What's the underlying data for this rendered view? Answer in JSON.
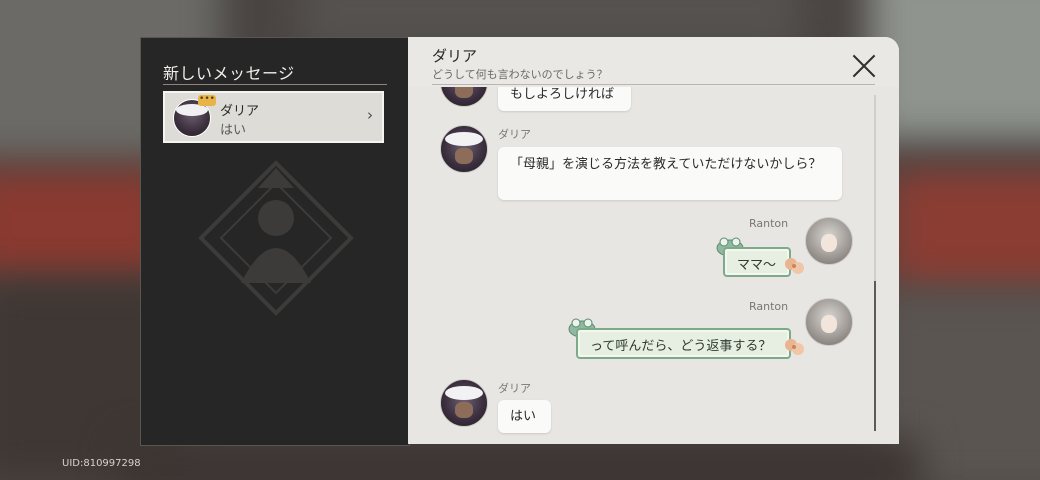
{
  "uid": "UID:810997298",
  "left_panel": {
    "title": "新しいメッセージ",
    "conversation": {
      "name": "ダリア",
      "preview": "はい",
      "typing_badge": "•••",
      "chevron": "›"
    }
  },
  "chat": {
    "title": "ダリア",
    "status": "どうして何も言わないのでしょう？",
    "messages": [
      {
        "sender": "",
        "text": "もしよろしければ",
        "side": "left"
      },
      {
        "sender": "ダリア",
        "text": "「母親」を演じる方法を教えていただけないかしら？",
        "side": "left"
      },
      {
        "sender": "Ranton",
        "text": "ママ〜",
        "side": "right"
      },
      {
        "sender": "Ranton",
        "text": "って呼んだら、どう返事する？",
        "side": "right"
      },
      {
        "sender": "ダリア",
        "text": "はい",
        "side": "left"
      }
    ]
  },
  "icons": {
    "close": "close-icon",
    "emblem": "emblem-icon"
  },
  "colors": {
    "left_bg": "#262626",
    "chat_bg": "#e7e6e3",
    "player_bubble_border": "#7faa89",
    "player_bubble_bg": "#e6efe1",
    "badge": "#e8b44a"
  }
}
